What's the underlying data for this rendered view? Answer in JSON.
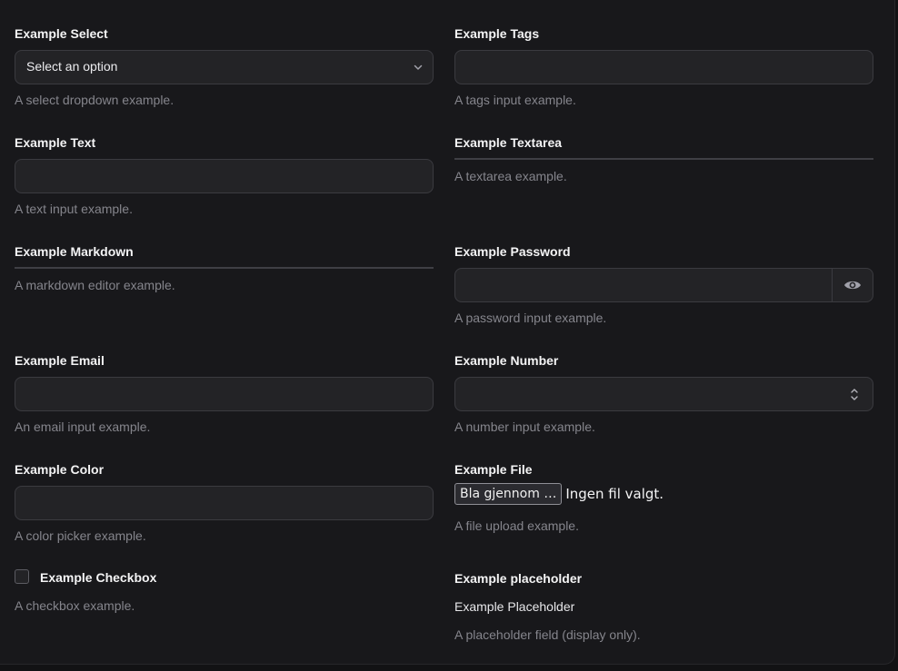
{
  "fields": {
    "select": {
      "label": "Example Select",
      "value": "Select an option",
      "help": "A select dropdown example."
    },
    "tags": {
      "label": "Example Tags",
      "value": "",
      "help": "A tags input example."
    },
    "text": {
      "label": "Example Text",
      "value": "",
      "help": "A text input example."
    },
    "textarea": {
      "label": "Example Textarea",
      "help": "A textarea example."
    },
    "markdown": {
      "label": "Example Markdown",
      "help": "A markdown editor example."
    },
    "password": {
      "label": "Example Password",
      "value": "",
      "help": "A password input example."
    },
    "email": {
      "label": "Example Email",
      "value": "",
      "help": "An email input example."
    },
    "number": {
      "label": "Example Number",
      "value": "",
      "help": "A number input example."
    },
    "color": {
      "label": "Example Color",
      "value": "",
      "help": "A color picker example."
    },
    "file": {
      "label": "Example File",
      "button_label": "Bla gjennom …",
      "status": "Ingen fil valgt.",
      "help": "A file upload example."
    },
    "checkbox": {
      "label": "Example Checkbox",
      "checked": false,
      "help": "A checkbox example."
    },
    "placeholder": {
      "label": "Example placeholder",
      "value": "Example Placeholder",
      "help": "A placeholder field (display only)."
    }
  },
  "icons": {
    "select": "chevron-down-icon",
    "password": "eye-icon",
    "number": "spinner-arrows-icon"
  },
  "colors": {
    "background": "#18181b",
    "input_bg": "#232326",
    "input_border": "#3b3b40",
    "help_text": "#85858c"
  }
}
